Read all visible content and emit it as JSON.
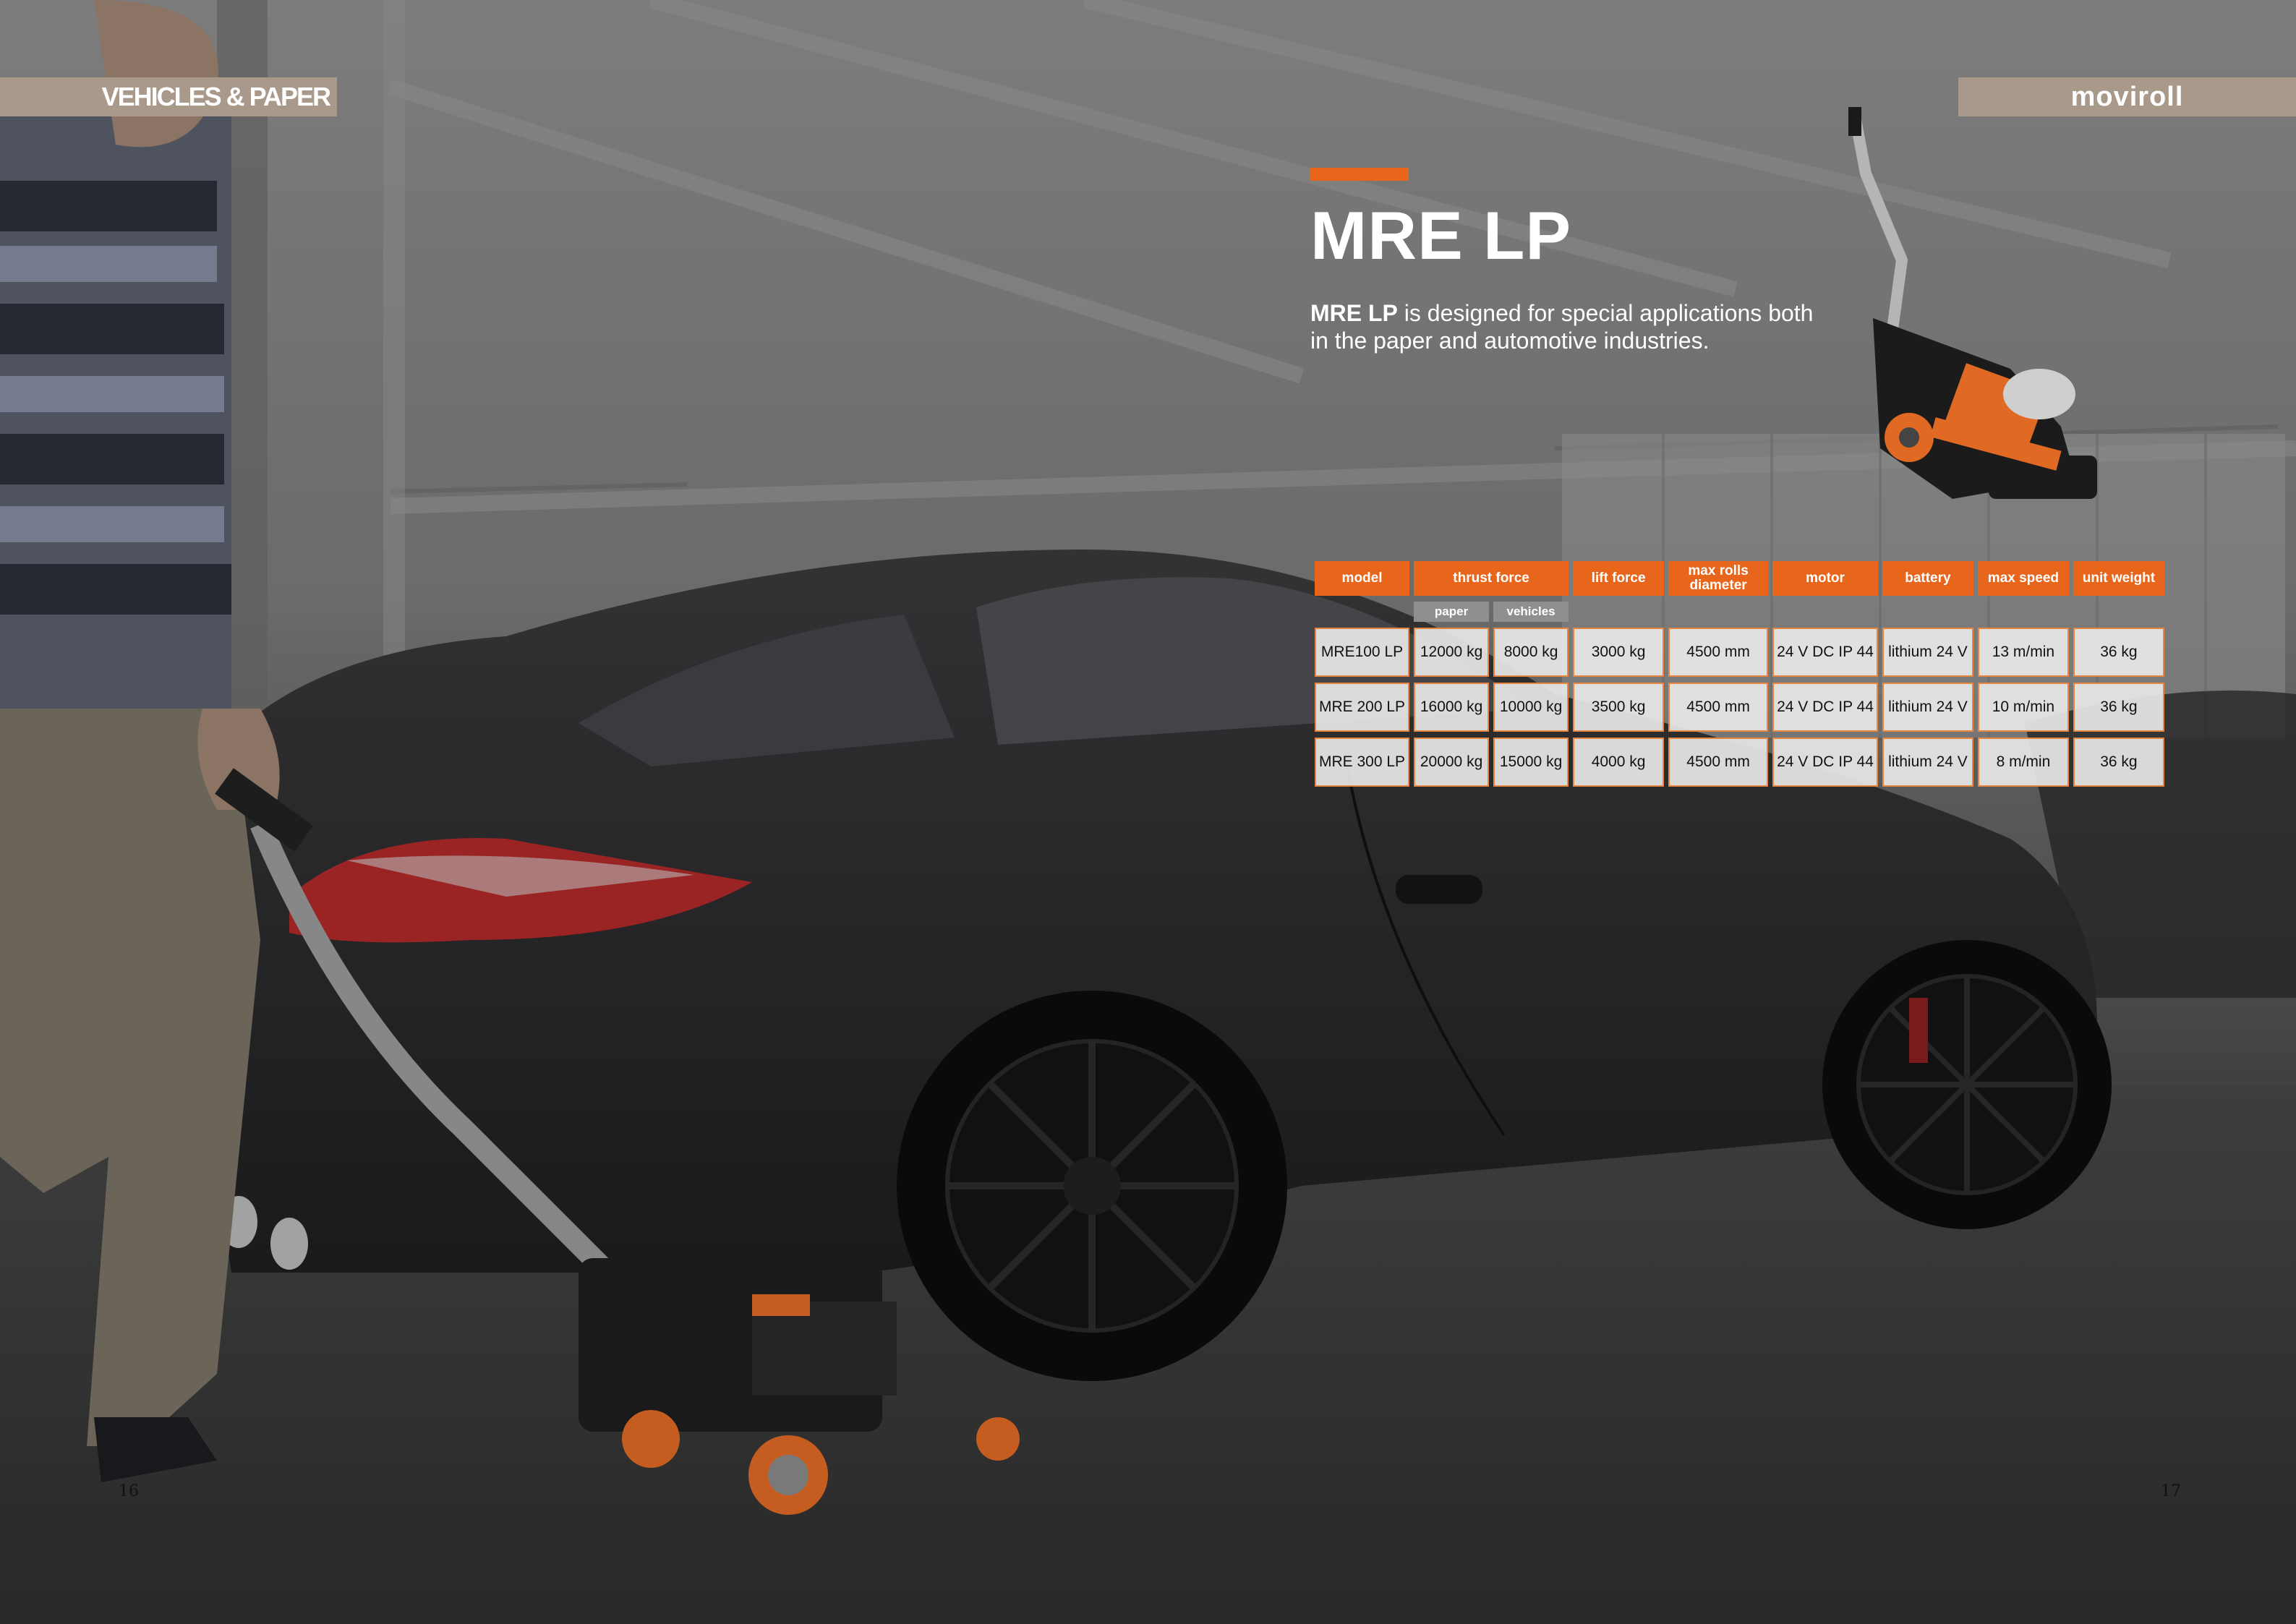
{
  "header": {
    "section_tag": "VEHICLES & PAPER",
    "brand": "moviroll"
  },
  "product": {
    "title": "MRE LP",
    "intro_bold": "MRE LP",
    "intro_text": "is designed for special applications both in the paper and automotive industries."
  },
  "table": {
    "headers": [
      "model",
      "thrust force",
      "lift force",
      "max rolls diameter",
      "motor",
      "battery",
      "max speed",
      "unit weight"
    ],
    "subheaders": [
      "paper",
      "vehicles"
    ],
    "rows": [
      [
        "MRE100 LP",
        "12000 kg",
        "8000 kg",
        "3000 kg",
        "4500 mm",
        "24 V DC IP 44",
        "lithium 24 V",
        "13 m/min",
        "36 kg"
      ],
      [
        "MRE 200 LP",
        "16000 kg",
        "10000 kg",
        "3500 kg",
        "4500 mm",
        "24 V DC IP 44",
        "lithium 24 V",
        "10 m/min",
        "36 kg"
      ],
      [
        "MRE 300 LP",
        "20000 kg",
        "15000 kg",
        "4000 kg",
        "4500 mm",
        "24 V DC IP 44",
        "lithium 24 V",
        "8 m/min",
        "36 kg"
      ]
    ]
  },
  "page_numbers": {
    "left": "16",
    "right": "17"
  },
  "colors": {
    "accent": "#e8661c",
    "tag": "#a8998b"
  }
}
